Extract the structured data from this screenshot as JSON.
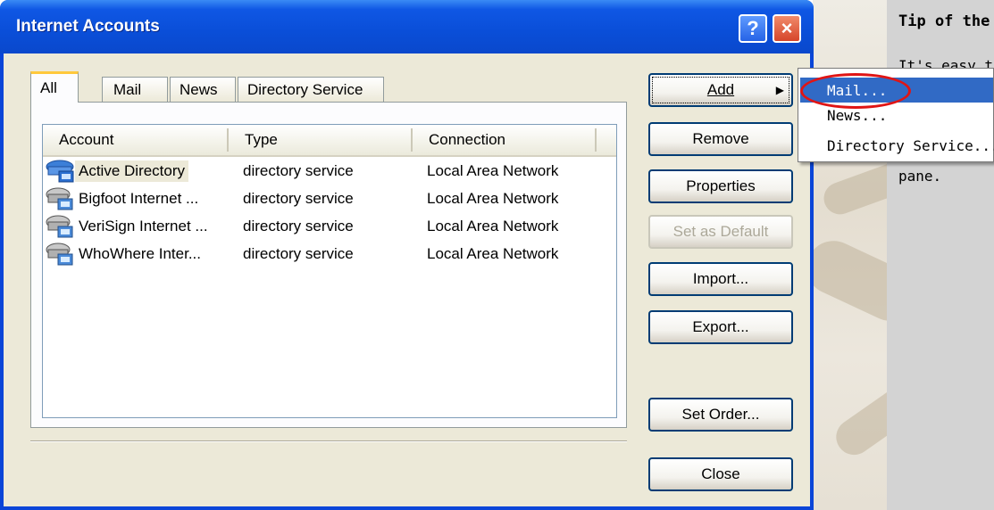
{
  "window": {
    "title": "Internet Accounts",
    "help_label": "?",
    "close_label": "×"
  },
  "tabs": [
    {
      "label": "All",
      "active": true
    },
    {
      "label": "Mail",
      "active": false
    },
    {
      "label": "News",
      "active": false
    },
    {
      "label": "Directory Service",
      "active": false
    }
  ],
  "list": {
    "columns": [
      "Account",
      "Type",
      "Connection"
    ],
    "rows": [
      {
        "account": "Active Directory",
        "type": "directory service",
        "connection": "Local Area Network",
        "icon": "active-directory-icon"
      },
      {
        "account": "Bigfoot Internet ...",
        "type": "directory service",
        "connection": "Local Area Network",
        "icon": "directory-service-icon"
      },
      {
        "account": "VeriSign Internet ...",
        "type": "directory service",
        "connection": "Local Area Network",
        "icon": "directory-service-icon"
      },
      {
        "account": "WhoWhere Inter...",
        "type": "directory service",
        "connection": "Local Area Network",
        "icon": "directory-service-icon"
      }
    ]
  },
  "buttons": {
    "add": "Add",
    "remove": "Remove",
    "properties": "Properties",
    "set_default": "Set as Default",
    "import": "Import...",
    "export": "Export...",
    "set_order": "Set Order...",
    "close": "Close"
  },
  "add_menu": {
    "items": [
      "Mail...",
      "News...",
      "Directory Service..."
    ]
  },
  "tip": {
    "title": "Tip of the",
    "line1": "It's easy to",
    "line4": "pane."
  },
  "colors": {
    "title_bar": "#0a4ed8",
    "menu_highlight": "#316ac5",
    "annotation": "#e01515"
  }
}
